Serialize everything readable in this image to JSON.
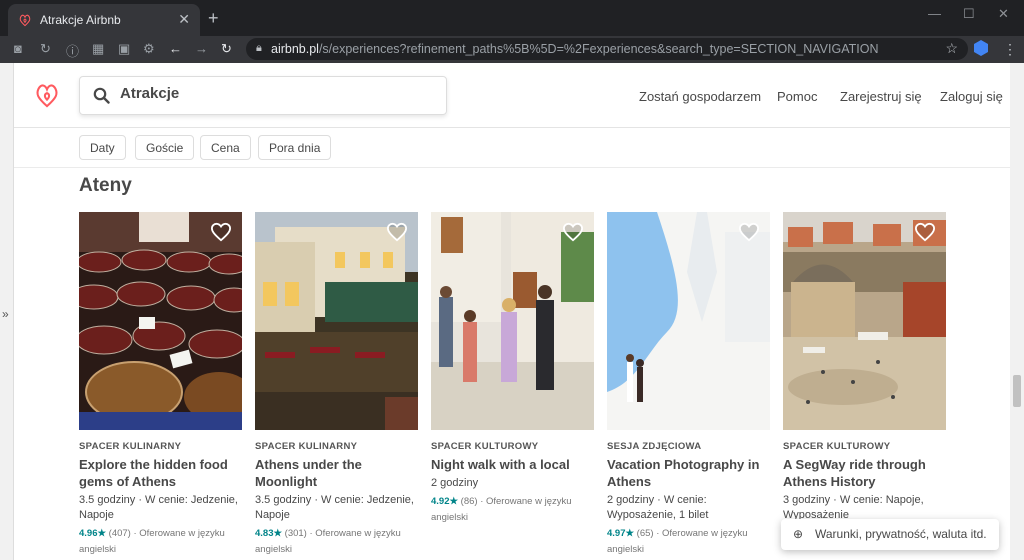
{
  "browser": {
    "tab_title": "Atrakcje Airbnb",
    "url_domain": "airbnb.pl",
    "url_path": "/s/experiences?refinement_paths%5B%5D=%2Fexperiences&search_type=SECTION_NAVIGATION"
  },
  "header": {
    "search_value": "Atrakcje",
    "nav": [
      "Zostań gospodarzem",
      "Pomoc",
      "Zarejestruj się",
      "Zaloguj się"
    ]
  },
  "filters": [
    "Daty",
    "Goście",
    "Cena",
    "Pora dnia"
  ],
  "section_title": "Ateny",
  "cards": [
    {
      "category": "SPACER KULINARNY",
      "name": "Explore the hidden food gems of Athens",
      "meta": "3.5 godziny · W cenie: Jedzenie, Napoje",
      "score": "4.96★",
      "reviews": "(407) · Oferowane w języku angielski"
    },
    {
      "category": "SPACER KULINARNY",
      "name": "Athens under the Moonlight",
      "meta": "3.5 godziny · W cenie: Jedzenie, Napoje",
      "score": "4.83★",
      "reviews": "(301) · Oferowane w języku angielski"
    },
    {
      "category": "SPACER KULTUROWY",
      "name": "Night walk with a local",
      "meta": "2 godziny",
      "score": "4.92★",
      "reviews": "(86) · Oferowane w języku angielski"
    },
    {
      "category": "SESJA ZDJĘCIOWA",
      "name": "Vacation Photography in Athens",
      "meta": "2 godziny · W cenie: Wyposażenie, 1 bilet",
      "score": "4.97★",
      "reviews": "(65) · Oferowane w języku angielski"
    },
    {
      "category": "SPACER KULTUROWY",
      "name": "A SegWay ride through Athens History",
      "meta": "3 godziny · W cenie: Napoje, Wyposażenie",
      "score": "",
      "reviews": ""
    }
  ],
  "toast": "Warunki, prywatność, waluta itd.",
  "colors": {
    "brand": "#ff5a5f",
    "rating": "#008489"
  }
}
